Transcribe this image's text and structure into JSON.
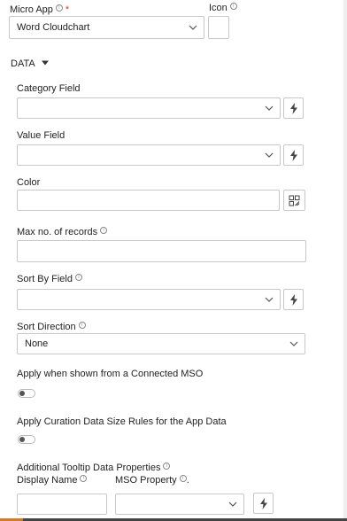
{
  "micro_app": {
    "label": "Micro App",
    "required_mark": "*",
    "value": "Word Cloudchart"
  },
  "icon": {
    "label": "Icon"
  },
  "section": {
    "title": "DATA"
  },
  "fields": {
    "category_field": {
      "label": "Category Field",
      "value": ""
    },
    "value_field": {
      "label": "Value Field",
      "value": ""
    },
    "color": {
      "label": "Color",
      "value": ""
    },
    "max_records": {
      "label": "Max no. of records",
      "value": ""
    },
    "sort_by_field": {
      "label": "Sort By Field",
      "value": ""
    },
    "sort_direction": {
      "label": "Sort Direction",
      "value": "None"
    },
    "apply_connected_mso": {
      "label": "Apply when shown from a Connected MSO",
      "enabled": false
    },
    "apply_curation_rules": {
      "label": "Apply Curation Data Size Rules for the App Data",
      "enabled": false
    },
    "tooltip_properties": {
      "label": "Additional Tooltip Data Properties",
      "display_name_label": "Display Name",
      "mso_property_label": "MSO Property",
      "mso_property_suffix": ".",
      "display_name_value": "",
      "mso_property_value": ""
    }
  },
  "icons": {
    "info": "info-icon",
    "dropdown": "chevron-down-icon",
    "dynamic": "lightning-icon",
    "color_picker": "palette-icon",
    "caret": "caret-down-icon"
  },
  "colors": {
    "required": "#d9363e",
    "border": "#c8c8c8",
    "accent": "#d07a2c"
  }
}
